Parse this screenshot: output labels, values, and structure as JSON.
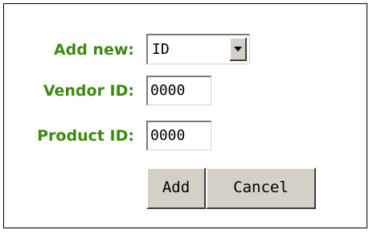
{
  "form": {
    "add_new_label": "Add new:",
    "add_new_value": "ID",
    "vendor_id_label": "Vendor ID:",
    "vendor_id_value": "0000",
    "product_id_label": "Product ID:",
    "product_id_value": "0000",
    "add_button_label": "Add",
    "cancel_button_label": "Cancel"
  },
  "colors": {
    "label_green": "#3d8a0f",
    "button_face": "#d4d0c8",
    "border": "#000000"
  },
  "icons": {
    "select_arrow": "chevron-down-icon"
  }
}
